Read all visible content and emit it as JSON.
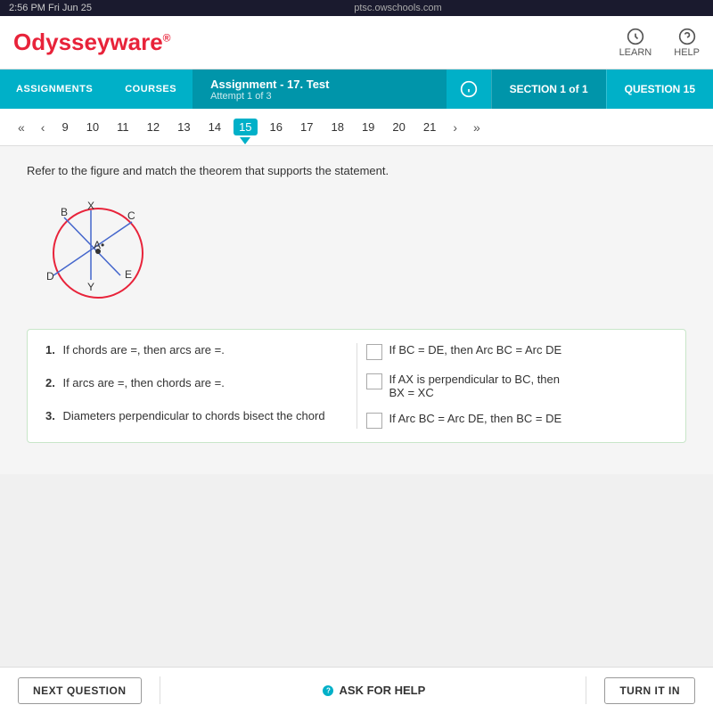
{
  "statusBar": {
    "time": "2:56 PM  Fri Jun 25",
    "url": "ptsc.owschools.com"
  },
  "topNav": {
    "logo": "Odysseyware",
    "learnLabel": "LEARN",
    "helpLabel": "HELP"
  },
  "assignmentBar": {
    "assignmentsLabel": "ASSIGNMENTS",
    "coursesLabel": "COURSES",
    "assignmentTitle": "Assignment  - 17. Test",
    "attemptLabel": "Attempt 1 of 3",
    "sectionLabel": "SECTION 1 of 1",
    "questionLabel": "QUESTION 15"
  },
  "pagination": {
    "items": [
      "9",
      "10",
      "11",
      "12",
      "13",
      "14",
      "15",
      "16",
      "17",
      "18",
      "19",
      "20",
      "21"
    ],
    "activeIndex": 6
  },
  "question": {
    "prompt": "Refer to the figure and match the theorem that supports the statement.",
    "leftItems": [
      {
        "num": "1.",
        "text": "If chords are =, then arcs are =."
      },
      {
        "num": "2.",
        "text": "If arcs are =, then chords are =."
      },
      {
        "num": "3.",
        "text": "Diameters perpendicular to chords bisect the chord"
      }
    ],
    "rightItems": [
      {
        "text": "If BC = DE, then Arc BC = Arc DE"
      },
      {
        "text": "If AX is perpendicular to BC, then\nBX = XC"
      },
      {
        "text": "If Arc BC = Arc DE, then BC = DE"
      }
    ]
  },
  "bottomBar": {
    "nextQuestionLabel": "NEXT QUESTION",
    "askForHelpLabel": "ASK FOR HELP",
    "turnItInLabel": "TURN IT IN"
  }
}
